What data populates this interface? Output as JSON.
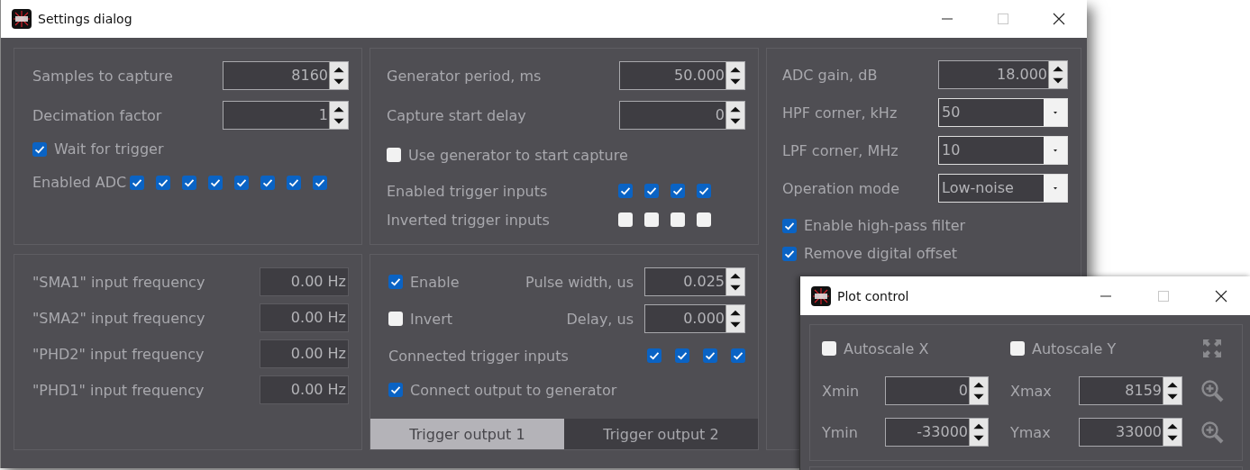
{
  "window": {
    "title": "Settings dialog"
  },
  "capture": {
    "fields": [
      {
        "label": "Samples to capture",
        "value": "8160"
      },
      {
        "label": "Decimation factor",
        "value": "1"
      }
    ],
    "wait_for_trigger": {
      "label": "Wait for trigger",
      "checked": true
    },
    "enabled_adc": {
      "label": "Enabled ADC",
      "checks": [
        true,
        true,
        true,
        true,
        true,
        true,
        true,
        true
      ]
    }
  },
  "generator": {
    "fields": [
      {
        "label": "Generator period, ms",
        "value": "50.000"
      },
      {
        "label": "Capture start delay",
        "value": "0"
      }
    ],
    "use_generator": {
      "label": "Use generator to start capture",
      "checked": false
    },
    "trigger_rows": [
      {
        "label": "Enabled trigger inputs",
        "checks": [
          true,
          true,
          true,
          true
        ]
      },
      {
        "label": "Inverted trigger inputs",
        "checks": [
          false,
          false,
          false,
          false
        ]
      }
    ]
  },
  "adc": {
    "gain": {
      "label": "ADC gain, dB",
      "value": "18.000"
    },
    "selects": [
      {
        "label": "HPF corner, kHz",
        "value": "50"
      },
      {
        "label": "LPF corner, MHz",
        "value": "10"
      },
      {
        "label": "Operation mode",
        "value": "Low-noise"
      }
    ],
    "options": [
      {
        "label": "Enable high-pass filter",
        "checked": true
      },
      {
        "label": "Remove digital offset",
        "checked": true
      }
    ]
  },
  "frequencies": [
    {
      "label": "\"SMA1\" input frequency",
      "value": "0.00 Hz"
    },
    {
      "label": "\"SMA2\" input frequency",
      "value": "0.00 Hz"
    },
    {
      "label": "\"PHD2\" input frequency",
      "value": "0.00 Hz"
    },
    {
      "label": "\"PHD1\" input frequency",
      "value": "0.00 Hz"
    }
  ],
  "trigger_output": {
    "enable": {
      "label": "Enable",
      "checked": true
    },
    "pulse_width": {
      "label": "Pulse width, us",
      "value": "0.025"
    },
    "invert": {
      "label": "Invert",
      "checked": false
    },
    "delay": {
      "label": "Delay, us",
      "value": "0.000"
    },
    "connected": {
      "label": "Connected trigger inputs",
      "checks": [
        true,
        true,
        true,
        true
      ]
    },
    "connect_generator": {
      "label": "Connect output to generator",
      "checked": true
    },
    "tabs": [
      {
        "label": "Trigger output 1",
        "selected": true
      },
      {
        "label": "Trigger output 2",
        "selected": false
      }
    ]
  },
  "plot_control": {
    "title": "Plot control",
    "autoscale": [
      {
        "label": "Autoscale X",
        "checked": false
      },
      {
        "label": "Autoscale Y",
        "checked": false
      }
    ],
    "ranges": [
      {
        "min_label": "Xmin",
        "min": "0",
        "max_label": "Xmax",
        "max": "8159"
      },
      {
        "min_label": "Ymin",
        "min": "-33000",
        "max_label": "Ymax",
        "max": "33000"
      }
    ]
  }
}
